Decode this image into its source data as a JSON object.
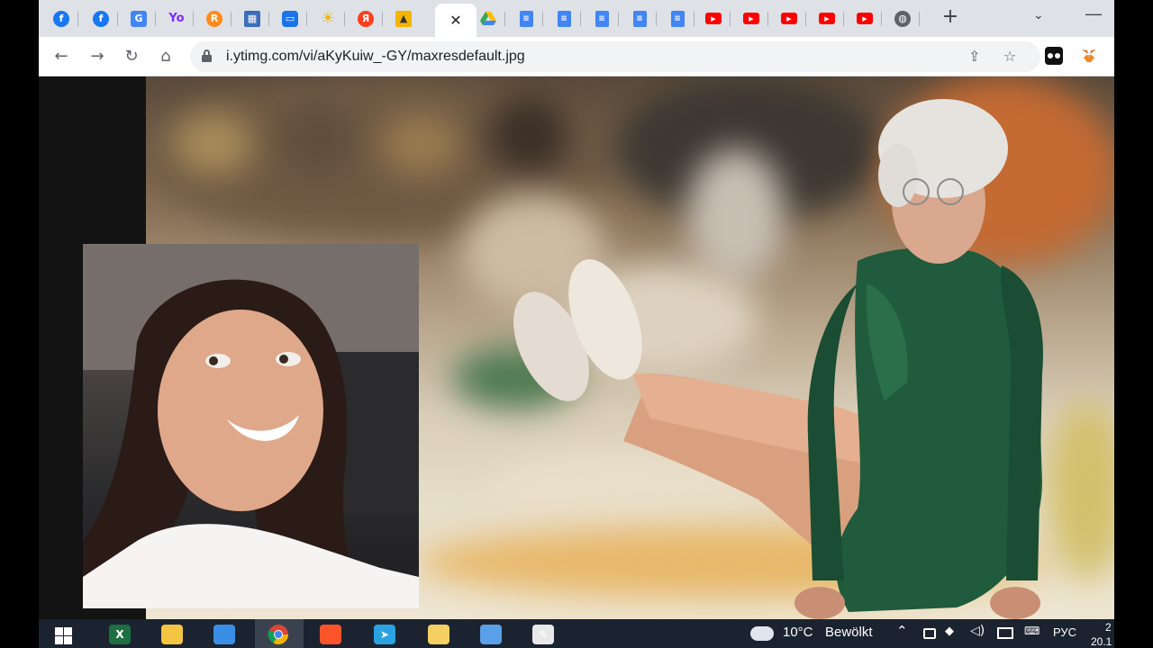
{
  "browser": {
    "url": "i.ytimg.com/vi/aKyKuiw_-GY/maxresdefault.jpg",
    "tabs": [
      {
        "icon": "facebook-icon",
        "glyph": "f",
        "cls": "fb"
      },
      {
        "icon": "facebook-icon",
        "glyph": "f",
        "cls": "fb"
      },
      {
        "icon": "translate-icon",
        "glyph": "G",
        "cls": "translate"
      },
      {
        "icon": "yo-icon",
        "glyph": "Yo",
        "cls": "yo"
      },
      {
        "icon": "lingualeo-icon",
        "glyph": "R",
        "cls": "orange"
      },
      {
        "icon": "layout-icon",
        "glyph": "▦",
        "cls": "layout"
      },
      {
        "icon": "chat-icon",
        "glyph": "▭",
        "cls": "chat"
      },
      {
        "icon": "sun-icon",
        "glyph": "☀",
        "cls": "sun"
      },
      {
        "icon": "yandex-icon",
        "glyph": "Я",
        "cls": "ya"
      },
      {
        "icon": "image-icon",
        "glyph": "▲",
        "cls": "img"
      },
      {
        "icon": "close-icon",
        "glyph": "✕",
        "cls": "active"
      },
      {
        "icon": "google-drive-icon",
        "glyph": "",
        "cls": "drive"
      },
      {
        "icon": "google-docs-icon",
        "glyph": "≡",
        "cls": "docs"
      },
      {
        "icon": "google-docs-icon",
        "glyph": "≡",
        "cls": "docs"
      },
      {
        "icon": "google-docs-icon",
        "glyph": "≡",
        "cls": "docs"
      },
      {
        "icon": "google-docs-icon",
        "glyph": "≡",
        "cls": "docs"
      },
      {
        "icon": "google-docs-icon",
        "glyph": "≡",
        "cls": "docs"
      },
      {
        "icon": "youtube-icon",
        "glyph": "▶",
        "cls": "yt"
      },
      {
        "icon": "youtube-icon",
        "glyph": "▶",
        "cls": "yt"
      },
      {
        "icon": "youtube-icon",
        "glyph": "▶",
        "cls": "yt"
      },
      {
        "icon": "youtube-icon",
        "glyph": "▶",
        "cls": "yt"
      },
      {
        "icon": "youtube-icon",
        "glyph": "▶",
        "cls": "yt"
      },
      {
        "icon": "globe-icon",
        "glyph": "◍",
        "cls": "globe"
      }
    ],
    "newtab_glyph": "+",
    "tabsearch_glyph": "⌄",
    "minimize_glyph": "—",
    "back_glyph": "←",
    "forward_glyph": "→",
    "reload_glyph": "↻",
    "home_glyph": "⌂",
    "share_glyph": "⇪",
    "bookmark_glyph": "☆"
  },
  "taskbar": {
    "apps": [
      {
        "name": "excel-icon",
        "color": "#1d6f42",
        "glyph": "X"
      },
      {
        "name": "file-explorer-icon",
        "color": "#f4c542",
        "glyph": ""
      },
      {
        "name": "remote-desktop-icon",
        "color": "#3a8ee6",
        "glyph": ""
      },
      {
        "name": "chrome-icon",
        "color": "#4285f4",
        "glyph": ""
      },
      {
        "name": "brave-icon",
        "color": "#fb542b",
        "glyph": ""
      },
      {
        "name": "telegram-icon",
        "color": "#2aa3e0",
        "glyph": "➤"
      },
      {
        "name": "notes-icon",
        "color": "#f5d061",
        "glyph": ""
      },
      {
        "name": "file-icon",
        "color": "#5aa0e8",
        "glyph": ""
      },
      {
        "name": "paint-icon",
        "color": "#e8e8e8",
        "glyph": "✎"
      }
    ],
    "weather": {
      "temp": "10°C",
      "condition": "Bewölkt"
    },
    "language": "РУС",
    "clock_partial": "2",
    "date_partial": "20.1"
  }
}
